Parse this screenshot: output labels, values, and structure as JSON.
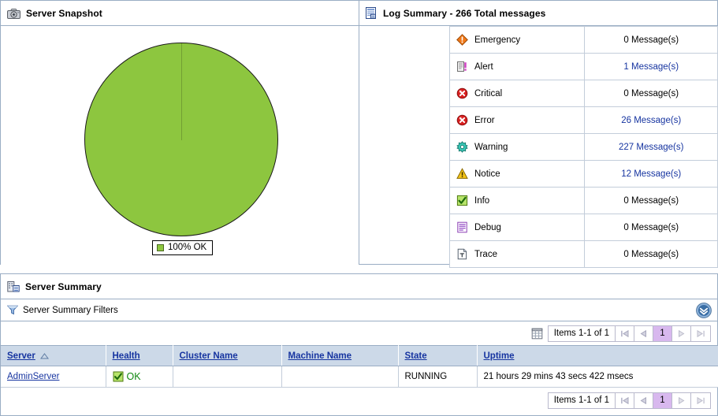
{
  "snapshot_panel": {
    "icon": "camera-icon",
    "title": "Server Snapshot",
    "chart_legend_label": "100% OK",
    "chart_color": "#8dc63f"
  },
  "log_summary_panel": {
    "icon": "log-document-icon",
    "title": "Log Summary - 266 Total messages",
    "total_messages": 266,
    "rows": [
      {
        "icon": "emergency-diamond-icon",
        "severity": "Emergency",
        "count_label": "0 Message(s)",
        "count": 0,
        "is_link": false
      },
      {
        "icon": "alert-document-icon",
        "severity": "Alert",
        "count_label": "1 Message(s)",
        "count": 1,
        "is_link": true
      },
      {
        "icon": "critical-x-icon",
        "severity": "Critical",
        "count_label": "0 Message(s)",
        "count": 0,
        "is_link": false
      },
      {
        "icon": "error-x-icon",
        "severity": "Error",
        "count_label": "26 Message(s)",
        "count": 26,
        "is_link": true
      },
      {
        "icon": "warning-gear-icon",
        "severity": "Warning",
        "count_label": "227 Message(s)",
        "count": 227,
        "is_link": true
      },
      {
        "icon": "notice-triangle-icon",
        "severity": "Notice",
        "count_label": "12 Message(s)",
        "count": 12,
        "is_link": true
      },
      {
        "icon": "info-check-icon",
        "severity": "Info",
        "count_label": "0 Message(s)",
        "count": 0,
        "is_link": false
      },
      {
        "icon": "debug-lines-icon",
        "severity": "Debug",
        "count_label": "0 Message(s)",
        "count": 0,
        "is_link": false
      },
      {
        "icon": "trace-page-icon",
        "severity": "Trace",
        "count_label": "0 Message(s)",
        "count": 0,
        "is_link": false
      }
    ]
  },
  "server_summary_panel": {
    "icon": "server-building-icon",
    "title": "Server Summary",
    "filters": {
      "icon": "funnel-icon",
      "label": "Server Summary Filters",
      "expand_icon": "chevron-down-circle-icon"
    },
    "pager": {
      "grid_icon": "table-grid-icon",
      "items_label": "Items 1-1 of 1",
      "first_icon": "first-page-icon",
      "prev_icon": "previous-page-icon",
      "current_page": "1",
      "next_icon": "next-page-icon",
      "last_icon": "last-page-icon"
    },
    "table": {
      "columns": [
        {
          "label": "Server",
          "sort_icon": "sort-ascending-icon"
        },
        {
          "label": "Health",
          "sort_icon": ""
        },
        {
          "label": "Cluster Name",
          "sort_icon": ""
        },
        {
          "label": "Machine Name",
          "sort_icon": ""
        },
        {
          "label": "State",
          "sort_icon": ""
        },
        {
          "label": "Uptime",
          "sort_icon": ""
        }
      ],
      "rows": [
        {
          "server": "AdminServer",
          "health_icon": "green-check-box-icon",
          "health": "OK",
          "cluster_name": "",
          "machine_name": "",
          "state": "RUNNING",
          "uptime": "21 hours 29 mins 43 secs 422 msecs"
        }
      ]
    }
  },
  "colors": {
    "panel_border": "#9aadc4",
    "header_bg": "#ccd9e8",
    "link": "#1634a0",
    "page_active_bg": "#d8b8ee",
    "ok_green": "#118811",
    "pie_green": "#8dc63f"
  }
}
